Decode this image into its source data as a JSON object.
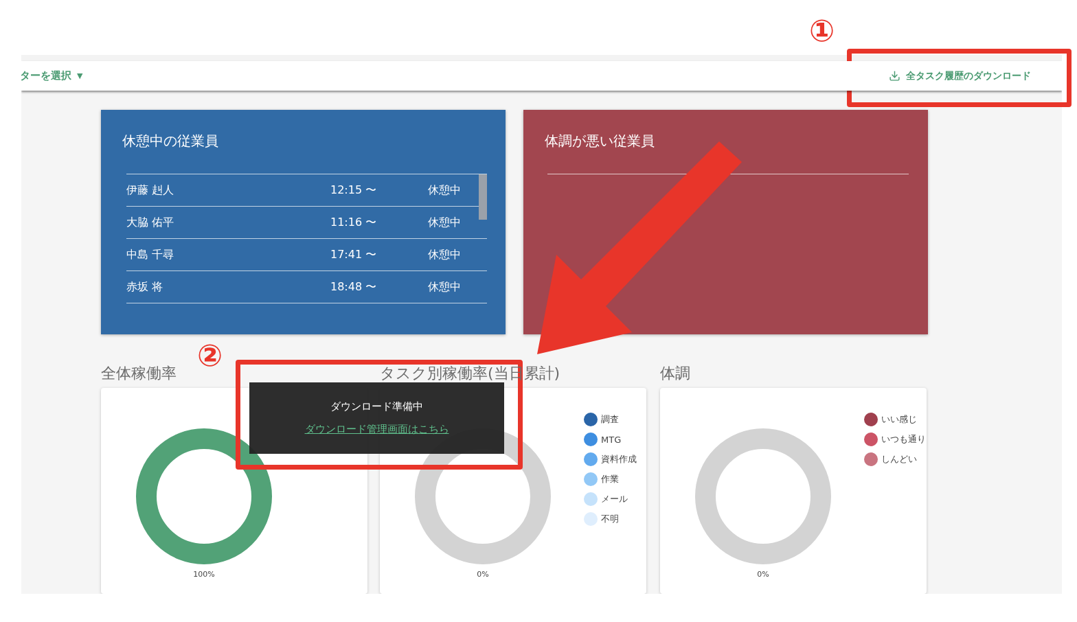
{
  "toolbar": {
    "filter_menu": "ターを選択",
    "filter_caret": "▼",
    "download_button": "全タスク履歴のダウンロード"
  },
  "resting_card": {
    "title": "休憩中の従業員",
    "rows": [
      {
        "name": "伊藤 赳人",
        "since": "12:15 〜",
        "status": "休憩中"
      },
      {
        "name": "大脇 佑平",
        "since": "11:16 〜",
        "status": "休憩中"
      },
      {
        "name": "中島 千尋",
        "since": "17:41 〜",
        "status": "休憩中"
      },
      {
        "name": "赤坂 将",
        "since": "18:48 〜",
        "status": "休憩中"
      }
    ]
  },
  "unwell_card": {
    "title": "体調が悪い従業員"
  },
  "charts": [
    {
      "title": "全体稼働率",
      "color": "#52a277",
      "percent": "100%"
    },
    {
      "title": "タスク別稼働率(当日累計)",
      "color": "#d3d3d3",
      "percent": "0%",
      "legend": [
        {
          "label": "調査",
          "color": "#2a65a8"
        },
        {
          "label": "MTG",
          "color": "#3e8ee0"
        },
        {
          "label": "資料作成",
          "color": "#62aaee"
        },
        {
          "label": "作業",
          "color": "#92c8f6"
        },
        {
          "label": "メール",
          "color": "#c5e2fb"
        },
        {
          "label": "不明",
          "color": "#dfeefd"
        }
      ]
    },
    {
      "title": "体調",
      "color": "#d3d3d3",
      "percent": "0%",
      "legend": [
        {
          "label": "いい感じ",
          "color": "#a0404e"
        },
        {
          "label": "いつも通り",
          "color": "#cc5466"
        },
        {
          "label": "しんどい",
          "color": "#c97480"
        }
      ]
    }
  ],
  "snackbar": {
    "message": "ダウンロード準備中",
    "link": "ダウンロード管理画面はこちら"
  },
  "annotations": {
    "marker_1": "①",
    "marker_2": "②"
  }
}
